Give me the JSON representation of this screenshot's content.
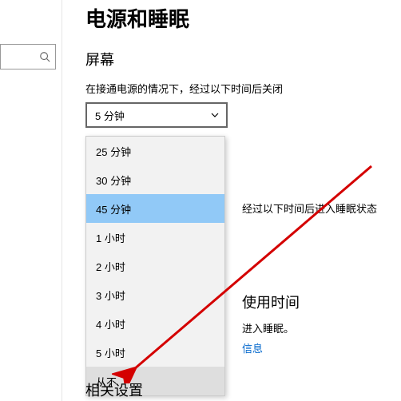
{
  "title": "电源和睡眠",
  "section_screen": "屏幕",
  "screen_desc": "在接通电源的情况下，经过以下时间后关闭",
  "screen_select_value": "5 分钟",
  "dropdown": {
    "items": [
      {
        "label": "25 分钟"
      },
      {
        "label": "30 分钟"
      },
      {
        "label": "45 分钟"
      },
      {
        "label": "1 小时"
      },
      {
        "label": "2 小时"
      },
      {
        "label": "3 小时"
      },
      {
        "label": "4 小时"
      },
      {
        "label": "5 小时"
      },
      {
        "label": "从不"
      }
    ]
  },
  "sleep_line_suffix": "经过以下时间后进入睡眠状态",
  "usage_time": {
    "title": "使用时间",
    "desc": "进入睡眠。",
    "link": "信息"
  },
  "related": "相关设置"
}
